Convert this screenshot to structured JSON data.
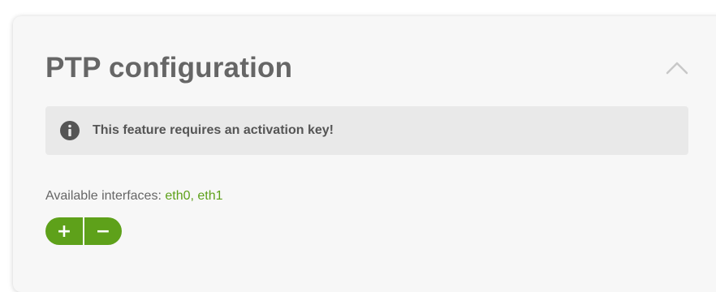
{
  "panel": {
    "title": "PTP configuration",
    "collapse_icon": "chevron-up-icon"
  },
  "notice": {
    "icon": "info-icon",
    "text": "This feature requires an activation key!"
  },
  "interfaces": {
    "label": "Available interfaces:",
    "list": "eth0, eth1"
  },
  "actions": {
    "add_label": "+",
    "remove_label": "−"
  },
  "colors": {
    "accent": "#5ea11a",
    "title": "#666666",
    "notice_bg": "#e9e9e9",
    "card_bg": "#f7f7f7"
  }
}
